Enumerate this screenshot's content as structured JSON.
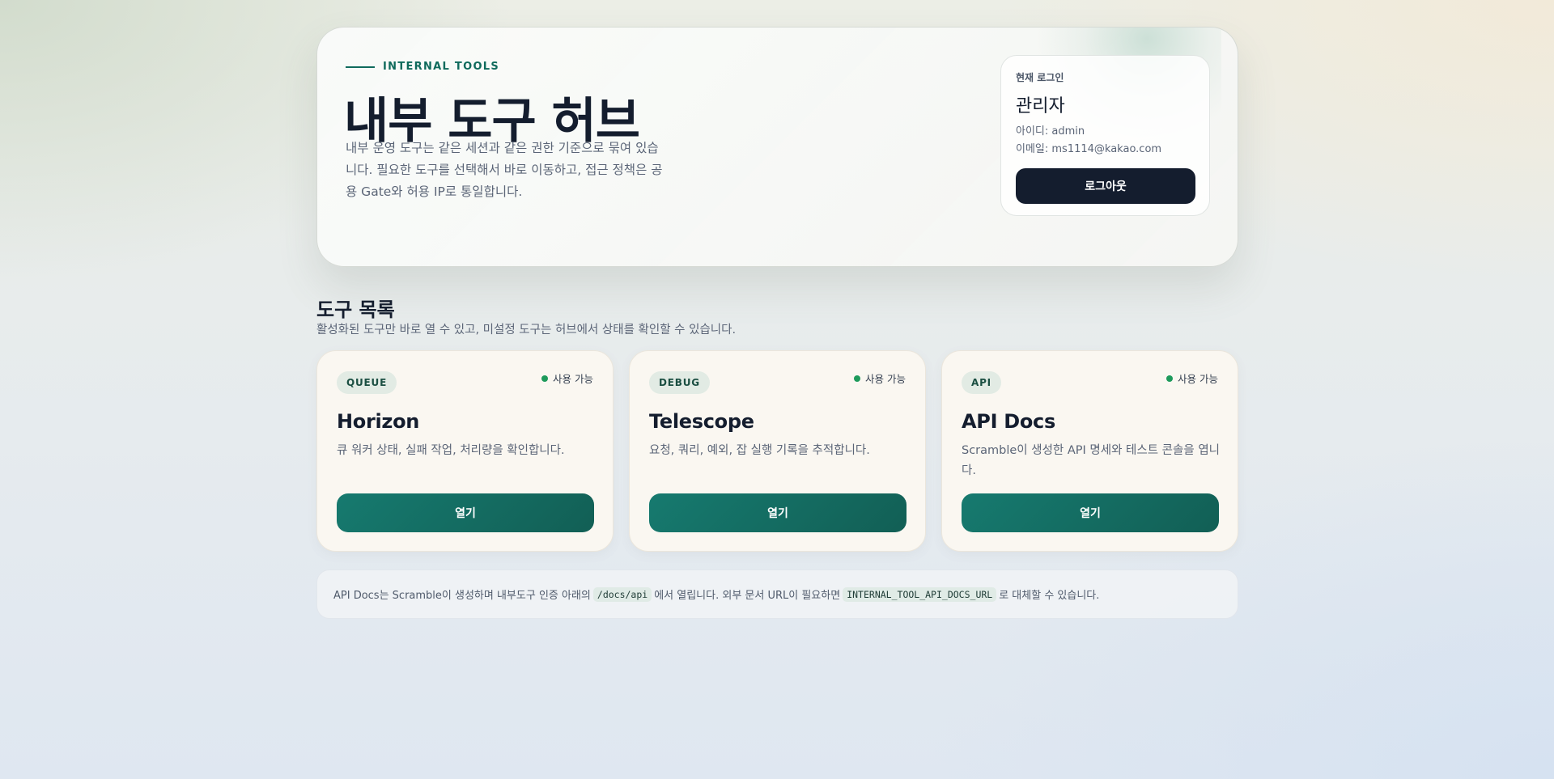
{
  "hero": {
    "eyebrow": "INTERNAL TOOLS",
    "title": "내부 도구 허브",
    "description": "내부 운영 도구는 같은 세션과 같은 권한 기준으로 묶여 있습니다. 필요한 도구를 선택해서 바로 이동하고, 접근 정책은 공용 Gate와 허용 IP로 통일합니다."
  },
  "login": {
    "label": "현재 로그인",
    "name": "관리자",
    "id_line": "아이디: admin",
    "email_line": "이메일: ms1114@kakao.com",
    "logout_label": "로그아웃"
  },
  "section": {
    "title": "도구 목록",
    "description": "활성화된 도구만 바로 열 수 있고, 미설정 도구는 허브에서 상태를 확인할 수 있습니다."
  },
  "status_color": "#1d9a5b",
  "accent_color": "#167a6f",
  "cards": [
    {
      "chip": "QUEUE",
      "status": "사용 가능",
      "title": "Horizon",
      "description": "큐 워커 상태, 실패 작업, 처리량을 확인합니다.",
      "button": "열기"
    },
    {
      "chip": "DEBUG",
      "status": "사용 가능",
      "title": "Telescope",
      "description": "요청, 쿼리, 예외, 잡 실행 기록을 추적합니다.",
      "button": "열기"
    },
    {
      "chip": "API",
      "status": "사용 가능",
      "title": "API Docs",
      "description": "Scramble이 생성한 API 명세와 테스트 콘솔을 엽니다.",
      "button": "열기"
    }
  ],
  "note": {
    "part1": "API Docs는 Scramble이 생성하며 내부도구 인증 아래의",
    "code1": "/docs/api",
    "part2": "에서 열립니다. 외부 문서 URL이 필요하면",
    "code2": "INTERNAL_TOOL_API_DOCS_URL",
    "part3": "로 대체할 수 있습니다."
  }
}
